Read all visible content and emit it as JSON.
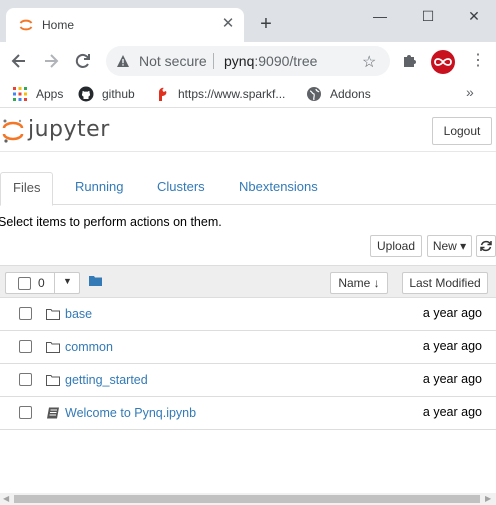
{
  "browser": {
    "tab_title": "Home",
    "tab_close": "✕",
    "new_tab": "+",
    "window_controls": {
      "minimize": "—",
      "maximize": "☐",
      "close": "✕"
    },
    "security_label": "Not secure",
    "url_host": "pynq",
    "url_rest": ":9090/tree",
    "bookmarks": [
      {
        "label": "Apps",
        "icon": "apps-grid-icon"
      },
      {
        "label": "github",
        "icon": "github-icon"
      },
      {
        "label": "https://www.sparkf...",
        "icon": "sparkfun-icon"
      },
      {
        "label": "Addons",
        "icon": "globe-icon"
      }
    ],
    "bookmarks_more": "»",
    "menu": "⋮"
  },
  "jupyter": {
    "logo_text": "jupyter",
    "logout_label": "Logout",
    "tabs": [
      {
        "label": "Files",
        "active": true
      },
      {
        "label": "Running",
        "active": false
      },
      {
        "label": "Clusters",
        "active": false
      },
      {
        "label": "Nbextensions",
        "active": false
      }
    ],
    "hint": "Select items to perform actions on them.",
    "upload_label": "Upload",
    "new_label": "New ▾",
    "selected_count": "0",
    "sort_name_label": "Name ↓",
    "last_modified_label": "Last Modified",
    "files": [
      {
        "name": "base",
        "type": "folder",
        "modified": "a year ago"
      },
      {
        "name": "common",
        "type": "folder",
        "modified": "a year ago"
      },
      {
        "name": "getting_started",
        "type": "folder",
        "modified": "a year ago"
      },
      {
        "name": "Welcome to Pynq.ipynb",
        "type": "notebook",
        "modified": "a year ago"
      }
    ]
  },
  "colors": {
    "link": "#337ab7",
    "jupyter_orange": "#f37726",
    "profile_red": "#c8101e"
  }
}
